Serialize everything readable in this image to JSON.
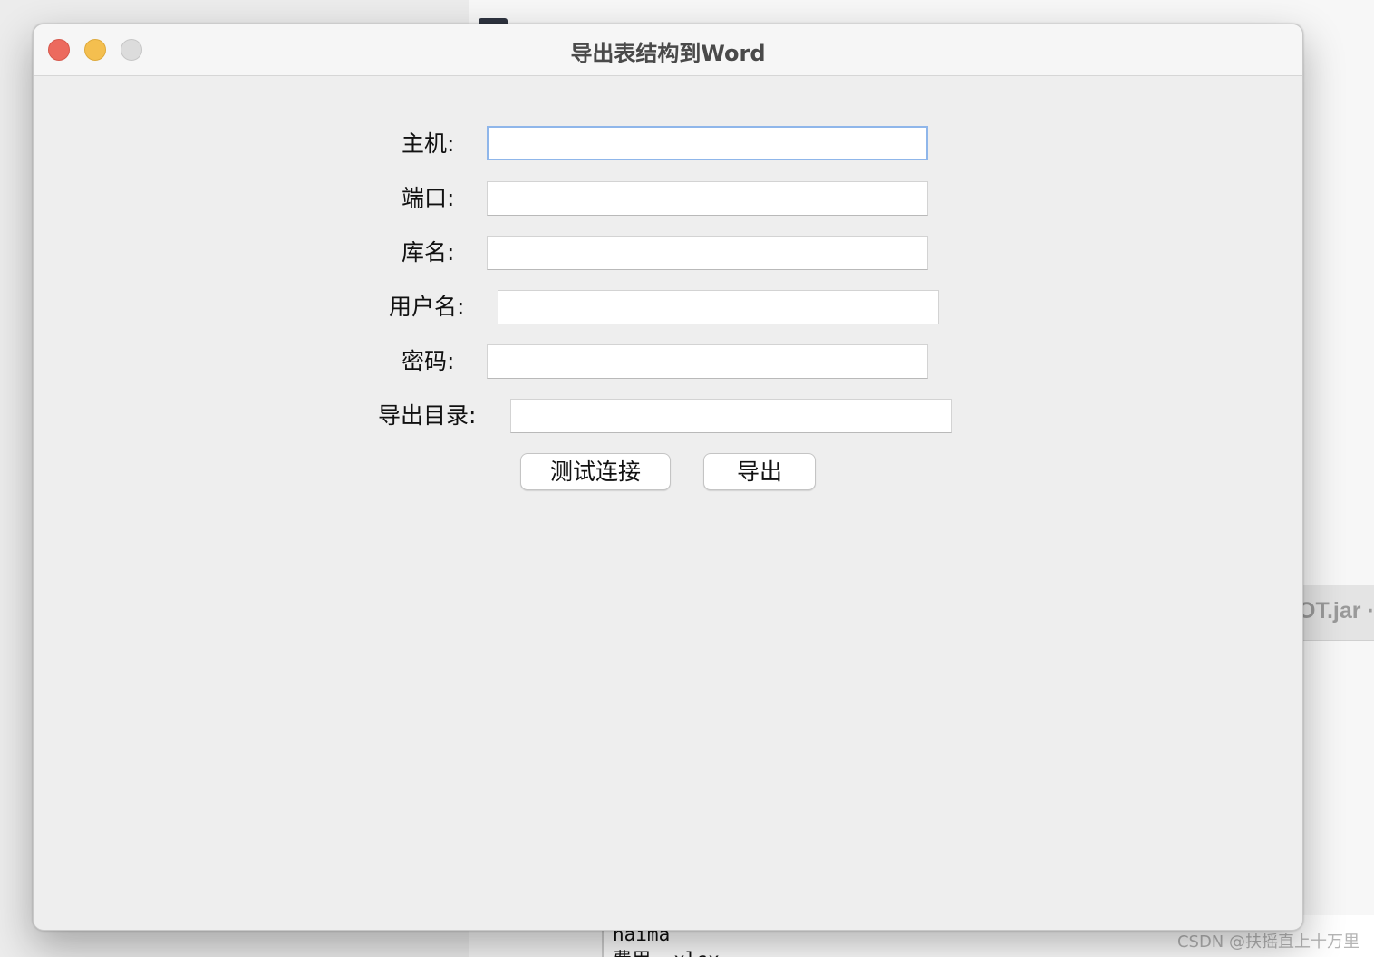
{
  "window": {
    "title": "导出表结构到Word"
  },
  "form": {
    "host_label": "主机:",
    "host_value": "",
    "port_label": "端口:",
    "port_value": "",
    "db_label": "库名:",
    "db_value": "",
    "user_label": "用户名:",
    "user_value": "",
    "password_label": "密码:",
    "password_value": "",
    "export_dir_label": "导出目录:",
    "export_dir_value": ""
  },
  "buttons": {
    "test_connection": "测试连接",
    "export": "导出"
  },
  "background": {
    "jar_tab_text": "OT.jar ·",
    "terminal_line1": "naima",
    "terminal_line2": "费用 .xlsx",
    "watermark": "CSDN @扶摇直上十万里"
  },
  "colors": {
    "close": "#ec6a5e",
    "minimize": "#f4bf4f",
    "maximize": "#dcdcdc",
    "focus_ring": "#8fb6ea"
  }
}
